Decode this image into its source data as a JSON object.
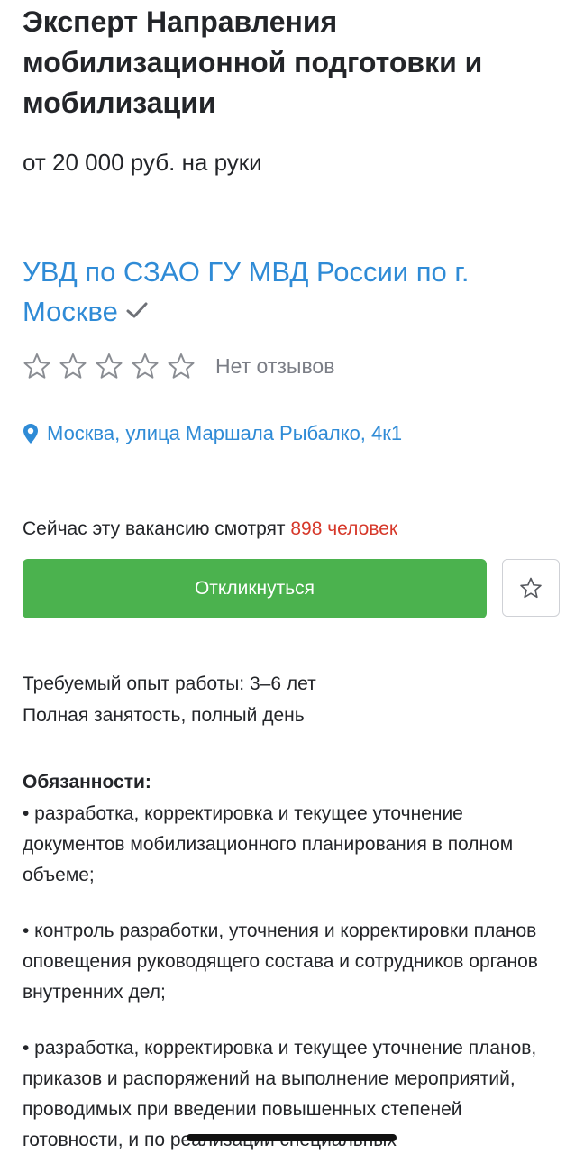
{
  "vacancy": {
    "title": "Эксперт Направления мобилизационной подготовки и мобилизации",
    "salary": "от 20 000 руб. на руки"
  },
  "company": {
    "name": "УВД по СЗАО ГУ МВД России по г. Москве",
    "verified_icon": "check-icon",
    "rating_stars": 0,
    "rating_max": 5,
    "reviews_text": "Нет отзывов"
  },
  "location": {
    "icon": "map-pin-icon",
    "address": "Москва, улица Маршала Рыбалко, 4к1"
  },
  "viewers": {
    "prefix": "Сейчас эту вакансию смотрят ",
    "count_text": "898 человек"
  },
  "actions": {
    "respond_label": "Откликнуться",
    "favorite_icon": "star-outline-icon"
  },
  "details": {
    "experience": "Требуемый опыт работы: 3–6 лет",
    "employment": "Полная занятость, полный день"
  },
  "duties": {
    "heading": "Обязанности:",
    "items": [
      "• разработка, корректировка и текущее уточнение документов мобилизационного планирования в полном объеме;",
      "• контроль разработки, уточнения и корректировки планов оповещения руководящего состава и сотрудников органов внутренних дел;",
      "• разработка, корректировка и текущее уточнение планов, приказов и распоряжений на выполнение мероприятий, проводимых при введении повышенных степеней готовности, и по реализации специальных"
    ]
  },
  "colors": {
    "link": "#2f8bd6",
    "accent_green": "#4bb24e",
    "count_red": "#d6382a",
    "muted_gray": "#7b7e86"
  }
}
